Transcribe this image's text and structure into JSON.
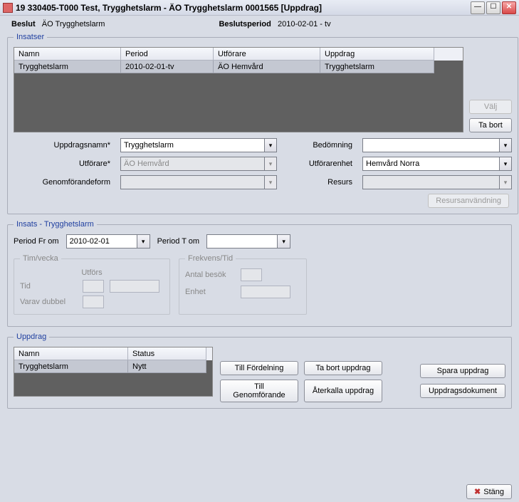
{
  "window": {
    "title": "19 330405-T000  Test, Trygghetslarm   -   ÄO Trygghetslarm   0001565   [Uppdrag]"
  },
  "header": {
    "beslut_label": "Beslut",
    "beslut_value": "ÄO Trygghetslarm",
    "beslutsperiod_label": "Beslutsperiod",
    "beslutsperiod_value": "2010-02-01 - tv"
  },
  "insatser": {
    "legend": "Insatser",
    "cols": {
      "namn": "Namn",
      "period": "Period",
      "utforare": "Utförare",
      "uppdrag": "Uppdrag"
    },
    "row": {
      "namn": "Trygghetslarm",
      "period": "2010-02-01-tv",
      "utforare": "ÄO Hemvård",
      "uppdrag": "Trygghetslarm"
    },
    "valj": "Välj",
    "tabort": "Ta bort"
  },
  "form": {
    "uppdragsnamn_label": "Uppdragsnamn*",
    "uppdragsnamn_value": "Trygghetslarm",
    "bedomning_label": "Bedömning",
    "bedomning_value": "",
    "utforare_label": "Utförare*",
    "utforare_value": "ÄO Hemvård",
    "utforarenhet_label": "Utförarenhet",
    "utforarenhet_value": "Hemvård Norra",
    "genomforandeform_label": "Genomförandeform",
    "genomforandeform_value": "",
    "resurs_label": "Resurs",
    "resurs_value": "",
    "resursanvandning": "Resursanvändning"
  },
  "insatsdetail": {
    "legend": "Insats - Trygghetslarm",
    "period_fr_label": "Period Fr om",
    "period_fr_value": "2010-02-01",
    "period_t_label": "Period T om",
    "period_t_value": "",
    "timvecka": {
      "legend": "Tim/vecka",
      "utfors": "Utförs",
      "tid": "Tid",
      "varav": "Varav dubbel"
    },
    "frekvens": {
      "legend": "Frekvens/Tid",
      "antal": "Antal besök",
      "enhet": "Enhet"
    }
  },
  "uppdrag": {
    "legend": "Uppdrag",
    "cols": {
      "namn": "Namn",
      "status": "Status"
    },
    "row": {
      "namn": "Trygghetslarm",
      "status": "Nytt"
    },
    "till_fordelning": "Till Fördelning",
    "ta_bort_uppdrag": "Ta bort uppdrag",
    "till_genomforande": "Till Genomförande",
    "aterkalla": "Återkalla uppdrag",
    "spara": "Spara uppdrag",
    "dokument": "Uppdragsdokument"
  },
  "footer": {
    "stang": "Stäng"
  }
}
